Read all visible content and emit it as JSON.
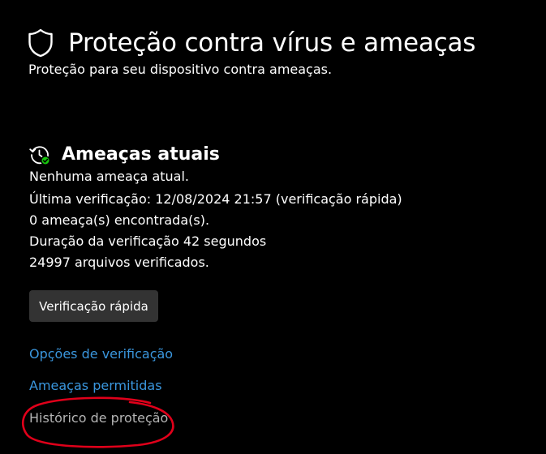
{
  "page": {
    "title": "Proteção contra vírus e ameaças",
    "subtitle": "Proteção para seu dispositivo contra ameaças.",
    "icon": "shield-icon"
  },
  "current_threats": {
    "title": "Ameaças atuais",
    "icon": "history-check-icon",
    "status": "Nenhuma ameaça atual.",
    "last_scan": "Última verificação: 12/08/2024 21:57 (verificação rápida)",
    "threats_found": "0 ameaça(s) encontrada(s).",
    "scan_duration": "Duração da verificação 42 segundos",
    "files_scanned": "24997 arquivos verificados.",
    "quick_scan_button": "Verificação rápida"
  },
  "links": {
    "scan_options": "Opções de verificação",
    "allowed_threats": "Ameaças permitidas",
    "protection_history": "Histórico de proteção"
  },
  "colors": {
    "background": "#000000",
    "text": "#ffffff",
    "link": "#3a96dd",
    "link_muted": "#b4b4b4",
    "button": "#333333",
    "check_badge": "#16c60c",
    "annotation": "#e0001a"
  }
}
